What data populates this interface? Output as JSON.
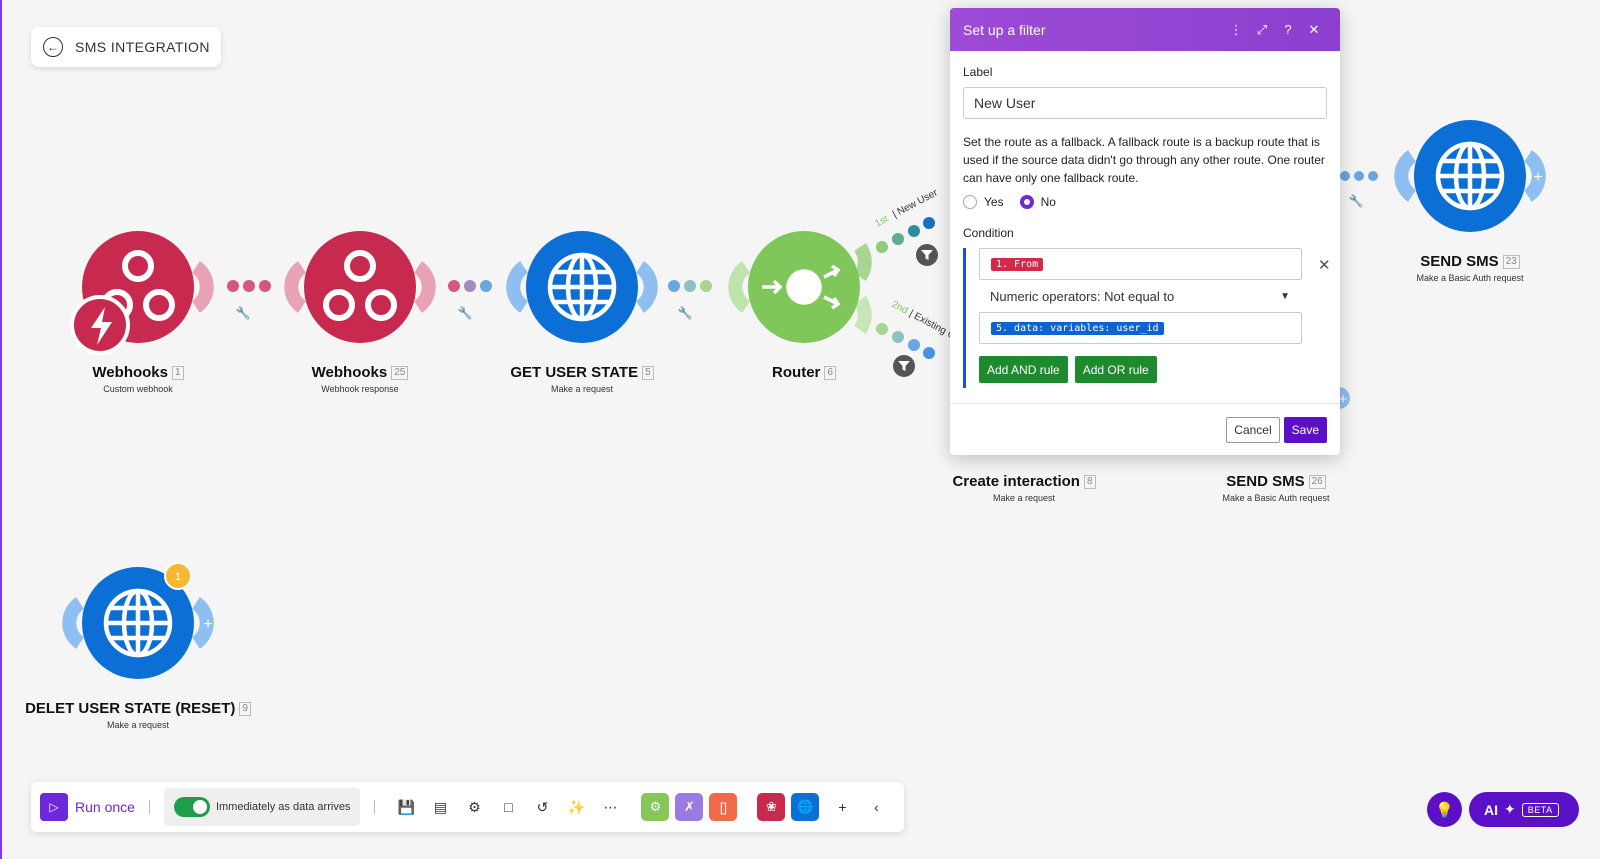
{
  "scenario": {
    "back_label": "SMS INTEGRATION"
  },
  "nodes": [
    {
      "name": "Webhooks",
      "id": "1",
      "subtitle": "Custom webhook"
    },
    {
      "name": "Webhooks",
      "id": "25",
      "subtitle": "Webhook response"
    },
    {
      "name": "GET USER STATE",
      "id": "5",
      "subtitle": "Make a request"
    },
    {
      "name": "Router",
      "id": "6",
      "subtitle": ""
    },
    {
      "name": "SEND SMS",
      "id": "23",
      "subtitle": "Make a Basic Auth request"
    },
    {
      "name": "Create interaction",
      "id": "8",
      "subtitle": "Make a request"
    },
    {
      "name": "SEND SMS",
      "id": "26",
      "subtitle": "Make a Basic Auth request"
    },
    {
      "name": "DELET USER STATE (RESET)",
      "id": "9",
      "subtitle": "Make a request",
      "badge": "1"
    }
  ],
  "routes": [
    {
      "order": "1st",
      "name": "New User"
    },
    {
      "order": "2nd",
      "name": "Existing Us"
    }
  ],
  "dialog": {
    "title": "Set up a filter",
    "label_caption": "Label",
    "label_value": "New User",
    "fallback_desc": "Set the route as a fallback. A fallback route is a backup route that is used if the source data didn't go through any other route. One router can have only one fallback route.",
    "radio_yes": "Yes",
    "radio_no": "No",
    "radio_selected": "No",
    "condition_caption": "Condition",
    "condition_left": "1. From",
    "operator": "Numeric operators: Not equal to",
    "condition_right": "5. data: variables: user_id",
    "add_and": "Add AND rule",
    "add_or": "Add OR rule",
    "cancel": "Cancel",
    "save": "Save"
  },
  "toolbar": {
    "run_once": "Run once",
    "schedule": "Immediately as data arrives"
  },
  "ai": {
    "label": "AI",
    "beta": "BETA"
  },
  "colors": {
    "webhook": "#c8294f",
    "http": "#0b6fd6",
    "router": "#7fc75a",
    "accent": "#6d28d9"
  }
}
